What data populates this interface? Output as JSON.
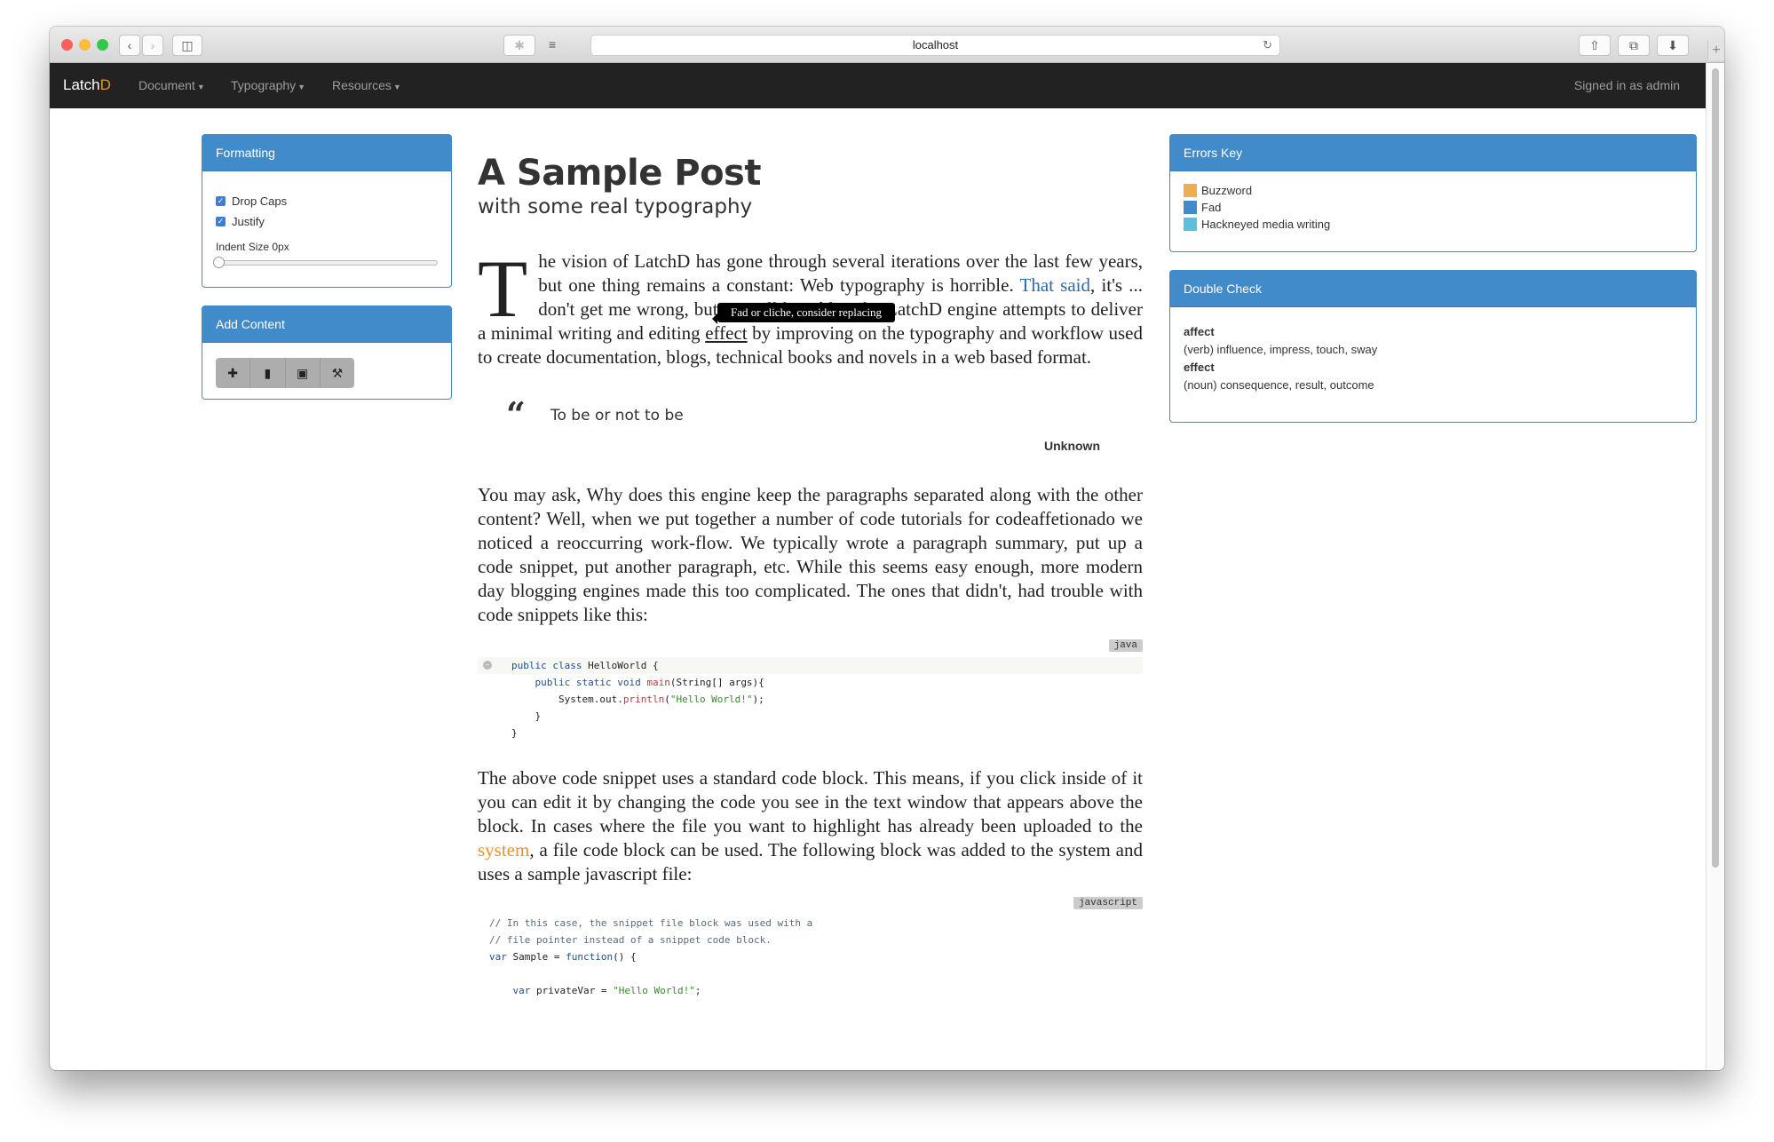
{
  "browser": {
    "url": "localhost",
    "colors": {
      "red": "#fc605b",
      "yellow": "#fdbc40",
      "green": "#34c84a"
    },
    "icons": [
      "back-icon",
      "forward-icon",
      "sidebar-icon",
      "extension-icon",
      "reader-icon",
      "reload-icon",
      "share-icon",
      "tabs-icon",
      "download-icon",
      "new-tab-icon"
    ]
  },
  "navbar": {
    "brand_main": "Latch",
    "brand_accent": "D",
    "items": [
      {
        "label": "Document"
      },
      {
        "label": "Typography"
      },
      {
        "label": "Resources"
      }
    ],
    "user_text": "Signed in as admin"
  },
  "formatting": {
    "title": "Formatting",
    "drop_caps": {
      "label": "Drop Caps",
      "checked": true
    },
    "justify": {
      "label": "Justify",
      "checked": true
    },
    "indent_label": "Indent Size 0px",
    "indent_value": 0
  },
  "add_content": {
    "title": "Add Content",
    "tools": [
      "plus-icon",
      "comment-icon",
      "image-icon",
      "wrench-icon"
    ]
  },
  "errors_key": {
    "title": "Errors Key",
    "items": [
      {
        "label": "Buzzword",
        "color": "#f0ad4e"
      },
      {
        "label": "Fad",
        "color": "#428bca"
      },
      {
        "label": "Hackneyed media writing",
        "color": "#5bc0de"
      }
    ]
  },
  "double_check": {
    "title": "Double Check",
    "entries": [
      {
        "word": "affect",
        "definition": "(verb) influence, impress, touch, sway"
      },
      {
        "word": "effect",
        "definition": "(noun) consequence, result, outcome"
      }
    ]
  },
  "article": {
    "title": "A Sample Post",
    "subtitle": "with some real typography",
    "p1": {
      "dropcap": "T",
      "a": "he vision of LatchD has gone through several iterations over the last few years, but one thing remains a constant: Web typography is horrible. ",
      "link": "That said",
      "b": ", it's ... don't get me wrong, but it's still horrible. The LatchD engine attempts to deliver a minimal writing and editing ",
      "underline": "effect",
      "c": " by improving on the typography and workflow used to create documentation, blogs, technical books and novels in a web based format."
    },
    "tooltip": "Fad or cliche, consider replacing",
    "quote": {
      "text": "To be or not to be",
      "author": "Unknown"
    },
    "p2": "You may ask, Why does this engine keep the paragraphs separated along with the other content? Well, when we put together a number of code tutorials for codeaffetionado we noticed a reoccurring work-flow. We typically wrote a paragraph summary, put up a code snippet, put another paragraph, etc. While this seems easy enough, more modern day blogging engines made this too complicated. The ones that didn't, had trouble with code snippets like this:",
    "code1_lang": "java",
    "p3": {
      "a": "The above code snippet uses a standard code block. This means, if you click inside of it you can edit it by changing the code you see in the text window that appears above the block. In cases where the file you want to highlight has already been uploaded to the ",
      "link": "system",
      "b": ", a file code block can be used. The following block was added to the system and uses a sample javascript file:"
    },
    "code2_lang": "javascript"
  }
}
